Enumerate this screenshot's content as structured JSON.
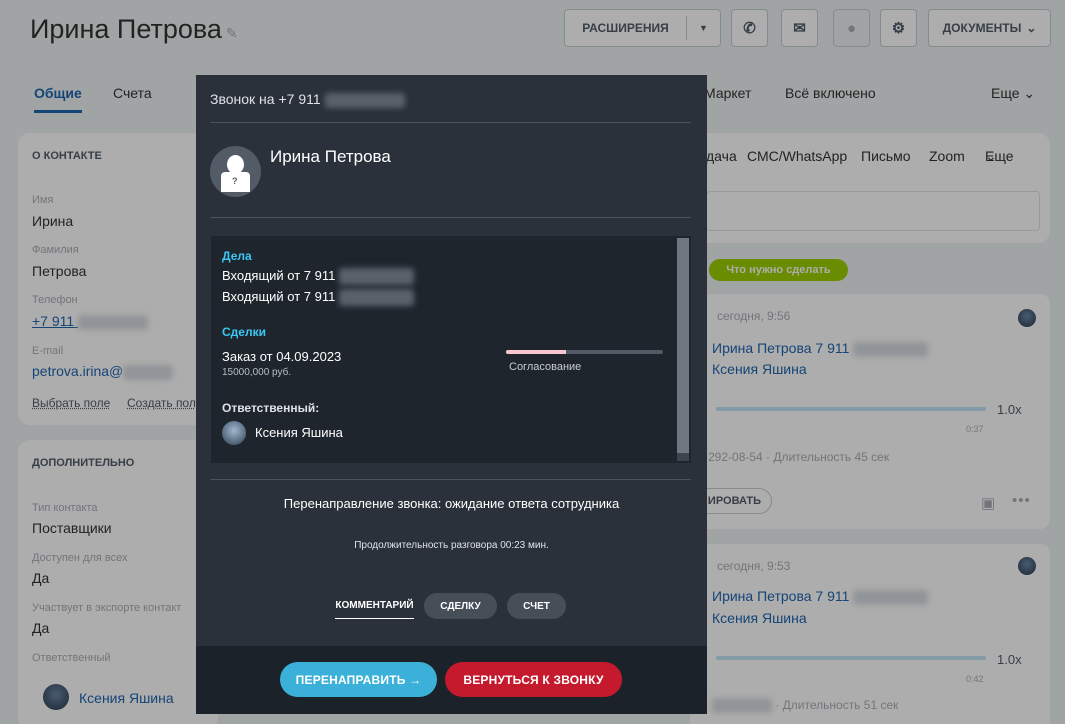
{
  "header": {
    "contact_title": "Ирина Петрова",
    "extensions_label": "РАСШИРЕНИЯ",
    "documents_label": "ДОКУМЕНТЫ"
  },
  "tabs": {
    "general": "Общие",
    "invoices": "Счета",
    "market": "Маркет",
    "all_included": "Всё включено",
    "more": "Еще"
  },
  "about": {
    "title": "О КОНТАКТЕ",
    "name_label": "Имя",
    "name_value": "Ирина",
    "lastname_label": "Фамилия",
    "lastname_value": "Петрова",
    "phone_label": "Телефон",
    "phone_value": "+7 911",
    "email_label": "E-mail",
    "email_value": "petrova.irina@",
    "select_field": "Выбрать поле",
    "create_field": "Создать пол"
  },
  "additional": {
    "title": "ДОПОЛНИТЕЛЬНО",
    "type_label": "Тип контакта",
    "type_value": "Поставщики",
    "available_label": "Доступен для всех",
    "available_value": "Да",
    "export_label": "Участвует в экспорте контакт",
    "export_value": "Да",
    "responsible_label": "Ответственный",
    "responsible_value": "Ксения Яшина"
  },
  "right_panel": {
    "tabs": [
      "дача",
      "СМС/WhatsApp",
      "Письмо",
      "Zoom",
      "Еще"
    ],
    "todo_badge": "Что нужно сделать",
    "item1": {
      "time": "сегодня, 9:56",
      "link1": "Ирина Петрова 7 911",
      "link2": "Ксения Яшина",
      "speed": "1.0x",
      "length": "0:37",
      "info": "292-08-54 · Длительность 45 сек",
      "btn": "ИРОВАТЬ"
    },
    "item2": {
      "time": "сегодня, 9:53",
      "link1": "Ирина Петрова 7 911",
      "link2": "Ксения Яшина",
      "speed": "1.0x",
      "length": "0:42",
      "info": "· Длительность 51 сек"
    }
  },
  "modal": {
    "title": "Звонок на +7 911",
    "contact_name": "Ирина Петрова",
    "tasks_title": "Дела",
    "task1": "Входящий от 7 911",
    "task2": "Входящий от 7 911",
    "deals_title": "Сделки",
    "deal_name": "Заказ от 04.09.2023",
    "deal_amount": "15000,000 руб.",
    "deal_stage": "Согласование",
    "deal_progress": 0.38,
    "responsible_title": "Ответственный:",
    "responsible_name": "Ксения Яшина",
    "status": "Перенаправление звонка: ожидание ответа сотрудника",
    "duration": "Продолжительность разговора 00:23 мин.",
    "tab_comment": "КОММЕНТАРИЙ",
    "tab_deal": "СДЕЛКУ",
    "tab_invoice": "СЧЕТ",
    "redirect_button": "ПЕРЕНАПРАВИТЬ →",
    "return_button": "ВЕРНУТЬСЯ К ЗВОНКУ"
  },
  "colors": {
    "accent_blue": "#2066b0",
    "badge_green": "#9dcf00",
    "modal_bg": "#2a313b",
    "redirect_blue": "#3bb0d8",
    "return_red": "#c51a2d",
    "section_cyan": "#3bc8f5"
  },
  "icons": {
    "phone": "phone-icon",
    "mail": "mail-icon",
    "chat": "chat-icon",
    "settings": "gear-icon",
    "edit": "pencil-icon"
  }
}
